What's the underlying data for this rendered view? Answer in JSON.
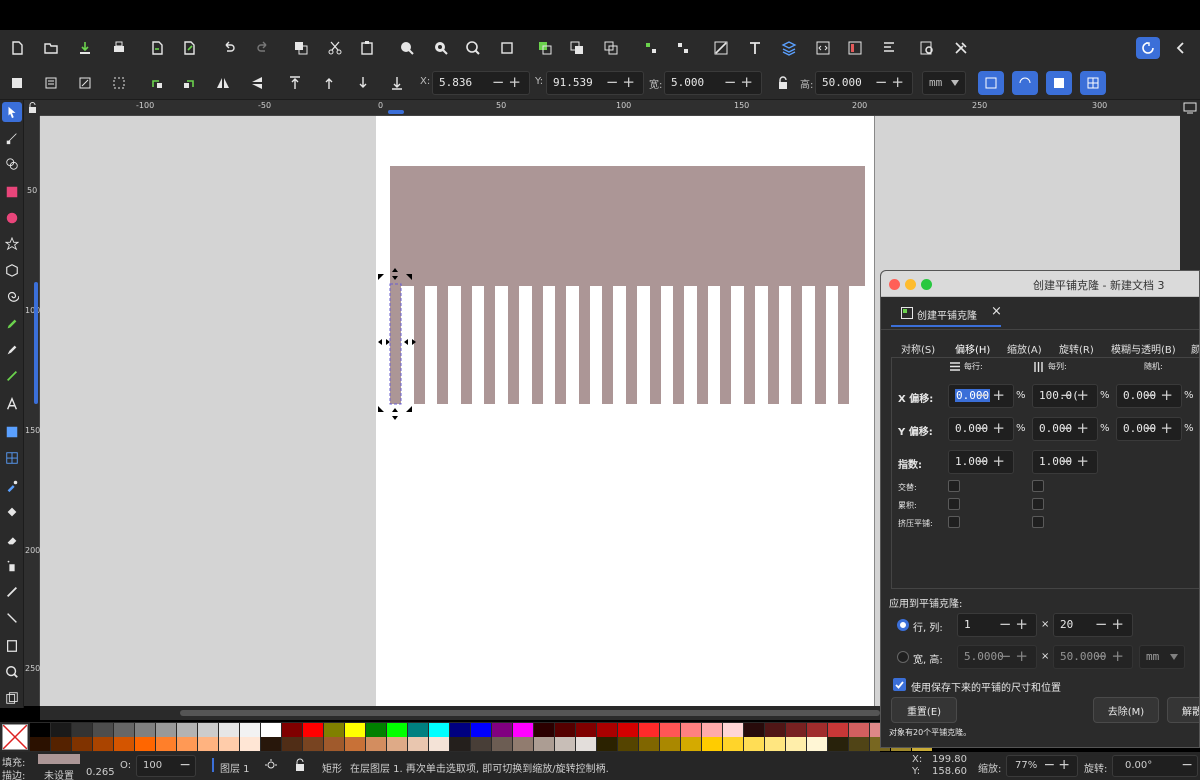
{
  "controls": {
    "x_label": "X:",
    "x_value": "5.836",
    "y_label": "Y:",
    "y_value": "91.539",
    "w_label": "宽:",
    "w_value": "5.000",
    "h_label": "高:",
    "h_value": "50.000",
    "unit": "mm"
  },
  "hruler_ticks": [
    "-100",
    "-50",
    "0",
    "50",
    "100",
    "150",
    "200",
    "250",
    "300"
  ],
  "vruler_ticks": [
    "50",
    "100",
    "150",
    "200",
    "250"
  ],
  "colors": {
    "rect": "#ac9696",
    "canvas_bg": "#d4d4d4",
    "accent": "#3b6fd8"
  },
  "stripe_count": 20,
  "dialog": {
    "title": "创建平铺克隆 - 新建文档 3",
    "tab_label": "创建平铺克隆",
    "tabs": [
      "对称(S)",
      "偏移(H)",
      "缩放(A)",
      "旋转(R)",
      "模糊与透明(B)",
      "颜"
    ],
    "col_row": "每行:",
    "col_col": "每列:",
    "col_rand": "随机:",
    "rows": [
      {
        "label": "X 偏移:",
        "v1": "0.000",
        "v2": "100.0(",
        "v3": "0.000"
      },
      {
        "label": "Y 偏移:",
        "v1": "0.000",
        "v2": "0.000",
        "v3": "0.000"
      },
      {
        "label": "指数:",
        "v1": "1.000",
        "v2": "1.000",
        "v3": ""
      }
    ],
    "pct": "%",
    "checks": [
      "交替:",
      "累积:",
      "挤压平铺:"
    ],
    "apply_label": "应用到平铺克隆:",
    "rowcol_label": "行, 列:",
    "rows_value": "1",
    "cols_value": "20",
    "wh_label": "宽, 高:",
    "w_value": "5.0000",
    "h_value": "50.0000",
    "unit": "mm",
    "times": "×",
    "use_saved": "使用保存下来的平铺的尺寸和位置",
    "reset": "重置(E)",
    "remove": "去除(M)",
    "unclump": "解散",
    "status": "对象有20个平铺克隆。"
  },
  "status": {
    "fill_label": "填充:",
    "stroke_label": "描边:",
    "stroke_value": "未设置",
    "stroke_width": "0.265",
    "opacity_label": "O:",
    "opacity_value": "100",
    "layer": "图层 1",
    "message_obj": "矩形",
    "message": "在层图层 1. 再次单击选取项, 即可切换到缩放/旋转控制柄.",
    "x_label": "X:",
    "x": "199.80",
    "y_label": "Y:",
    "y": "158.60",
    "zoom_label": "缩放:",
    "zoom": "77%",
    "rotate_label": "旋转:",
    "rotate": "0.00°"
  }
}
